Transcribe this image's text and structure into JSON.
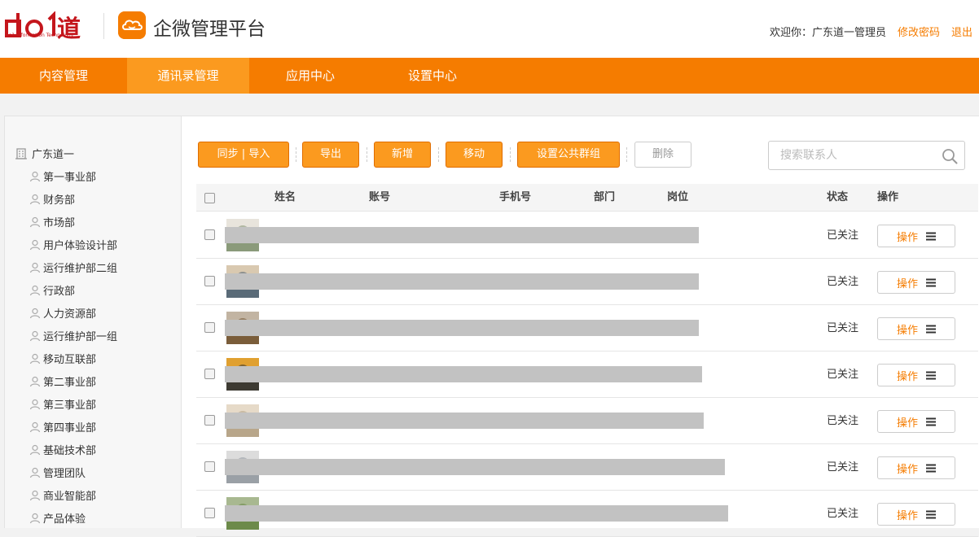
{
  "brand": {
    "logo_text": "DO1道",
    "logo_subtext": "Do1 Information Technology",
    "app_title": "企微管理平台",
    "accent_color": "#f57c00"
  },
  "header": {
    "welcome": "欢迎你：广东道一管理员",
    "change_password": "修改密码",
    "logout": "退出"
  },
  "nav": {
    "items": [
      {
        "label": "内容管理",
        "active": false
      },
      {
        "label": "通讯录管理",
        "active": true
      },
      {
        "label": "应用中心",
        "active": false
      },
      {
        "label": "设置中心",
        "active": false
      }
    ]
  },
  "sidebar": {
    "root": {
      "label": "广东道一",
      "icon": "building-icon"
    },
    "items": [
      {
        "label": "第一事业部",
        "icon": "person-icon"
      },
      {
        "label": "财务部",
        "icon": "person-icon"
      },
      {
        "label": "市场部",
        "icon": "person-icon"
      },
      {
        "label": "用户体验设计部",
        "icon": "person-icon"
      },
      {
        "label": "运行维护部二组",
        "icon": "person-icon"
      },
      {
        "label": "行政部",
        "icon": "person-icon"
      },
      {
        "label": "人力资源部",
        "icon": "person-icon"
      },
      {
        "label": "运行维护部一组",
        "icon": "person-icon"
      },
      {
        "label": "移动互联部",
        "icon": "person-icon"
      },
      {
        "label": "第二事业部",
        "icon": "person-icon"
      },
      {
        "label": "第三事业部",
        "icon": "person-icon"
      },
      {
        "label": "第四事业部",
        "icon": "person-icon"
      },
      {
        "label": "基础技术部",
        "icon": "person-icon"
      },
      {
        "label": "管理团队",
        "icon": "person-icon"
      },
      {
        "label": "商业智能部",
        "icon": "person-icon"
      },
      {
        "label": "产品体验",
        "icon": "person-icon"
      }
    ]
  },
  "toolbar": {
    "sync_import": "同步 | 导入",
    "export": "导出",
    "add": "新增",
    "move": "移动",
    "set_public_group": "设置公共群组",
    "delete": "删除"
  },
  "search": {
    "placeholder": "搜索联系人"
  },
  "table": {
    "headers": {
      "name": "姓名",
      "account": "账号",
      "phone": "手机号",
      "department": "部门",
      "position": "岗位",
      "status": "状态",
      "action": "操作"
    },
    "rows": [
      {
        "status": "已关注",
        "action_label": "操作"
      },
      {
        "status": "已关注",
        "action_label": "操作"
      },
      {
        "status": "已关注",
        "action_label": "操作"
      },
      {
        "status": "已关注",
        "action_label": "操作"
      },
      {
        "status": "已关注",
        "action_label": "操作"
      },
      {
        "status": "已关注",
        "action_label": "操作"
      },
      {
        "status": "已关注",
        "action_label": "操作"
      }
    ]
  }
}
